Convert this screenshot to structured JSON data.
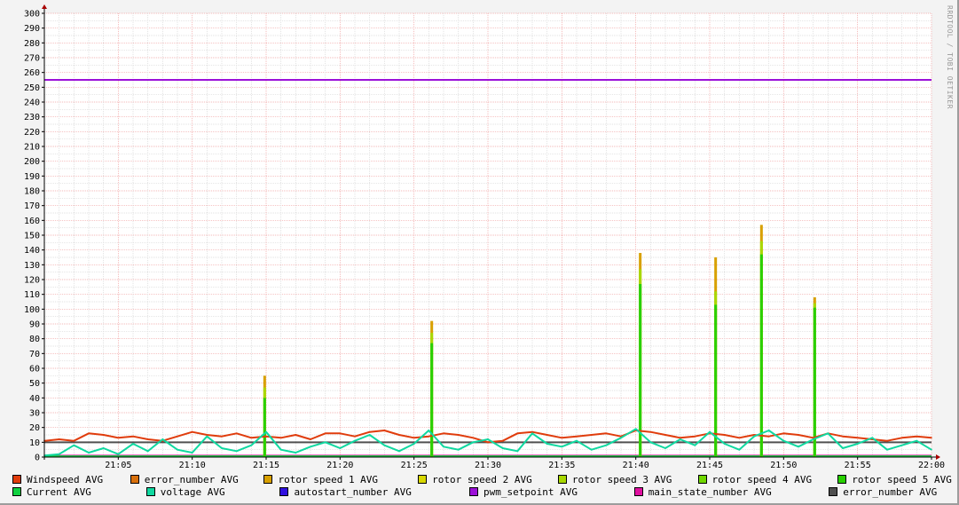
{
  "watermark": "RRDTOOL / TOBI OETIKER",
  "chart_data": {
    "type": "line",
    "title": "",
    "xlabel": "",
    "ylabel": "",
    "ylim": [
      0,
      300
    ],
    "y_ticks": [
      0,
      10,
      20,
      30,
      40,
      50,
      60,
      70,
      80,
      90,
      100,
      110,
      120,
      130,
      140,
      150,
      160,
      170,
      180,
      190,
      200,
      210,
      220,
      230,
      240,
      250,
      260,
      270,
      280,
      290,
      300
    ],
    "x_range_minutes": [
      0,
      60
    ],
    "x_ticks": [
      {
        "min": 5,
        "label": "21:05"
      },
      {
        "min": 10,
        "label": "21:10"
      },
      {
        "min": 15,
        "label": "21:15"
      },
      {
        "min": 20,
        "label": "21:20"
      },
      {
        "min": 25,
        "label": "21:25"
      },
      {
        "min": 30,
        "label": "21:30"
      },
      {
        "min": 35,
        "label": "21:35"
      },
      {
        "min": 40,
        "label": "21:40"
      },
      {
        "min": 45,
        "label": "21:45"
      },
      {
        "min": 50,
        "label": "21:50"
      },
      {
        "min": 55,
        "label": "21:55"
      },
      {
        "min": 60,
        "label": "22:00"
      }
    ],
    "grid": true,
    "legend_placement": "bottom",
    "legend": [
      {
        "name": "Windspeed AVG",
        "color": "#e03c0c"
      },
      {
        "name": "error_number AVG",
        "color": "#d8700c"
      },
      {
        "name": "rotor speed 1 AVG",
        "color": "#d8a000"
      },
      {
        "name": "rotor speed 2 AVG",
        "color": "#d8d800"
      },
      {
        "name": "rotor speed 3 AVG",
        "color": "#a8d800"
      },
      {
        "name": "rotor speed 4 AVG",
        "color": "#70d800"
      },
      {
        "name": "rotor speed 5 AVG",
        "color": "#28d000"
      },
      {
        "name": "Current AVG",
        "color": "#10d040"
      },
      {
        "name": "voltage AVG",
        "color": "#10d8a0"
      },
      {
        "name": "autostart_number AVG",
        "color": "#3010e0"
      },
      {
        "name": "pwm_setpoint AVG",
        "color": "#9c10d8"
      },
      {
        "name": "main_state_number AVG",
        "color": "#e010a0"
      },
      {
        "name": "error_number AVG",
        "color": "#505050"
      }
    ],
    "series": [
      {
        "name": "Windspeed AVG",
        "color": "#e03c0c",
        "x_step_minutes": 1,
        "values": [
          11,
          12,
          11,
          16,
          15,
          13,
          14,
          12,
          11,
          14,
          17,
          15,
          14,
          16,
          13,
          14,
          13,
          15,
          12,
          16,
          16,
          14,
          17,
          18,
          15,
          13,
          14,
          16,
          15,
          13,
          10,
          11,
          16,
          17,
          15,
          13,
          14,
          15,
          16,
          14,
          18,
          17,
          15,
          13,
          14,
          16,
          15,
          13,
          15,
          14,
          16,
          15,
          13,
          16,
          14,
          13,
          12,
          11,
          13,
          14,
          13
        ]
      },
      {
        "name": "voltage AVG",
        "color": "#10d8a0",
        "x_step_minutes": 1,
        "values": [
          1,
          2,
          8,
          3,
          6,
          2,
          9,
          4,
          12,
          5,
          3,
          14,
          6,
          4,
          8,
          17,
          5,
          3,
          7,
          10,
          6,
          11,
          15,
          8,
          4,
          9,
          18,
          7,
          5,
          10,
          12,
          6,
          4,
          16,
          9,
          7,
          11,
          5,
          8,
          13,
          19,
          10,
          6,
          12,
          8,
          17,
          9,
          5,
          14,
          18,
          11,
          7,
          12,
          16,
          6,
          9,
          13,
          5,
          8,
          11,
          5
        ]
      },
      {
        "name": "pwm_setpoint AVG",
        "color": "#9c10d8",
        "constant": 255
      },
      {
        "name": "error_number AVG",
        "color": "#505050",
        "constant": 10
      },
      {
        "name": "main_state_number AVG",
        "color": "#e010a0",
        "constant": 1
      },
      {
        "name": "Current AVG",
        "color": "#10d040",
        "constant": 0.5
      }
    ],
    "rotor_spikes": [
      {
        "minute": 14.9,
        "rotor5": 40,
        "rotor3": 47,
        "rotor1": 55
      },
      {
        "minute": 26.2,
        "rotor5": 77,
        "rotor3": 84,
        "rotor1": 92
      },
      {
        "minute": 40.3,
        "rotor5": 117,
        "rotor3": 127,
        "rotor1": 138
      },
      {
        "minute": 45.4,
        "rotor5": 103,
        "rotor3": 112,
        "rotor1": 135
      },
      {
        "minute": 48.5,
        "rotor5": 137,
        "rotor3": 146,
        "rotor1": 157
      },
      {
        "minute": 52.1,
        "rotor5": 101,
        "rotor3": 104,
        "rotor1": 108
      }
    ]
  }
}
